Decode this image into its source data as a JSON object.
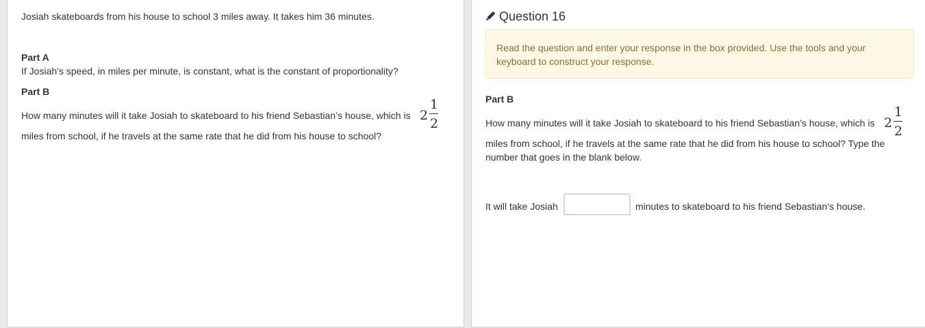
{
  "left_panel": {
    "intro": "Josiah skateboards from his house to school 3 miles away. It takes him 36 minutes.",
    "part_a_heading": "Part A",
    "part_a_text": "If Josiah’s speed, in miles per minute, is constant, what is the constant of proportionality?",
    "part_b_heading": "Part B",
    "part_b_text_line1": "How many minutes will it take Josiah to skateboard to his friend Sebastian’s house, which is",
    "part_b_text_line2": "miles from school, if he travels at the same rate that he did from his house to school?"
  },
  "mixed_number": {
    "whole": "2",
    "numerator": "1",
    "denominator": "2"
  },
  "right_panel": {
    "icon": "pencil-icon",
    "question_title": "Question 16",
    "instructions": "Read the question and enter your response in the box provided. Use the tools and your keyboard to construct your response.",
    "part_b_heading": "Part B",
    "part_b_text_line1": "How many minutes will it take Josiah to skateboard to his friend Sebastian’s house, which is",
    "part_b_text_line2": "miles from school, if he travels at the same rate that he did from his house to school? Type the",
    "part_b_text_line3": "number that goes in the blank below.",
    "answer_prefix": "It will take Josiah",
    "answer_value": "",
    "answer_suffix": "minutes to skateboard to his friend Sebastian’s house."
  },
  "colors": {
    "instructions_bg": "#fcf8e3",
    "instructions_text": "#8a6d3b",
    "panel_border": "#cfcfcf"
  }
}
